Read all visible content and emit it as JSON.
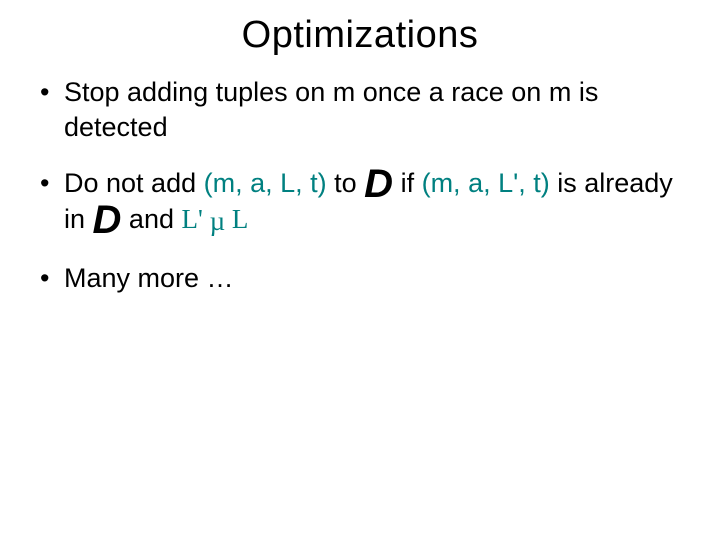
{
  "title": "Optimizations",
  "bullets": {
    "b1": "Stop adding tuples on m once a race on m is detected",
    "b2": {
      "pre": "Do not add ",
      "tuple1": "(m, a, L, t)",
      "mid1": " to ",
      "D1": "D",
      "mid2": "  if ",
      "tuple2": "(m, a, L', t)",
      "mid3": " is already in ",
      "D2": "D",
      "mid4": "  and ",
      "lprime": "L' ",
      "subset": "µ",
      "L": " L"
    },
    "b3": "Many more …"
  }
}
